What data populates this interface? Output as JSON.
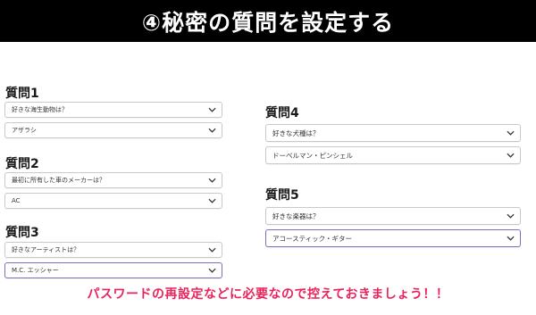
{
  "banner": {
    "title": "④秘密の質問を設定する"
  },
  "questions": [
    {
      "heading": "質問1",
      "question": "好きな海生動物は？",
      "answer": "アザラシ"
    },
    {
      "heading": "質問2",
      "question": "最初に所有した車のメーカーは？",
      "answer": "AC"
    },
    {
      "heading": "質問3",
      "question": "好きなアーティストは？",
      "answer": "M.C. エッシャー"
    },
    {
      "heading": "質問4",
      "question": "好きな犬種は？",
      "answer": "ドーベルマン・ピンシェル"
    },
    {
      "heading": "質問5",
      "question": "好きな楽器は？",
      "answer": "アコースティック・ギター"
    }
  ],
  "note": "パスワードの再設定などに必要なので控えておきましょう！！",
  "colors": {
    "banner_bg": "#000000",
    "note": "#e8245b",
    "focus_border": "#7a6fc4"
  },
  "icons": {
    "dropdown": "chevron-down-icon"
  }
}
